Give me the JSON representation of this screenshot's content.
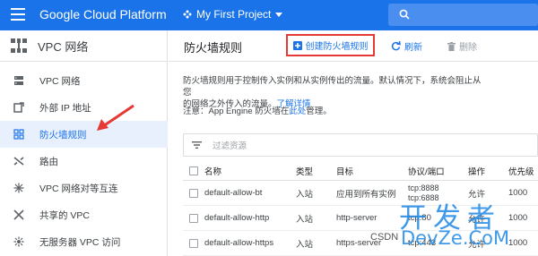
{
  "topbar": {
    "brand": "Google Cloud Platform",
    "project": "My First Project"
  },
  "sidebar": {
    "title": "VPC 网络",
    "items": [
      {
        "label": "VPC 网络",
        "icon": "network-icon"
      },
      {
        "label": "外部 IP 地址",
        "icon": "external-ip-icon"
      },
      {
        "label": "防火墙规则",
        "icon": "firewall-icon",
        "active": true
      },
      {
        "label": "路由",
        "icon": "route-icon"
      },
      {
        "label": "VPC 网络对等互连",
        "icon": "peering-icon"
      },
      {
        "label": "共享的 VPC",
        "icon": "shared-vpc-icon"
      },
      {
        "label": "无服务器 VPC 访问",
        "icon": "serverless-icon"
      }
    ]
  },
  "main": {
    "title": "防火墙规则",
    "create_label": "创建防火墙规则",
    "refresh_label": "刷新",
    "delete_label": "删除",
    "desc_line1": "防火墙规则用于控制传入实例和从实例传出的流量。默认情况下，系统会阻止从您",
    "desc_line2": "的网络之外传入的流量。",
    "learn_more": "了解详情",
    "note_prefix": "注意：App Engine 防火墙在",
    "note_link": "此处",
    "note_suffix": "管理。",
    "filter_placeholder": "过滤资源"
  },
  "table": {
    "headers": [
      "名称",
      "类型",
      "目标",
      "协议/端口",
      "操作",
      "优先级"
    ],
    "rows": [
      {
        "name": "default-allow-bt",
        "type": "入站",
        "target": "应用到所有实例",
        "proto1": "tcp:8888",
        "proto2": "tcp:6888",
        "action": "允许",
        "priority": "1000"
      },
      {
        "name": "default-allow-http",
        "type": "入站",
        "target": "http-server",
        "proto1": "tcp:80",
        "proto2": "",
        "action": "允许",
        "priority": "1000"
      },
      {
        "name": "default-allow-https",
        "type": "入站",
        "target": "https-server",
        "proto1": "tcp:443",
        "proto2": "",
        "action": "允许",
        "priority": "1000"
      }
    ]
  },
  "watermark": {
    "top": "开发者",
    "csdn": "CSDN",
    "bottom": "DevZe.CoM"
  },
  "colors": {
    "accent": "#1a73e8",
    "highlight_border": "#e53935",
    "active_bg": "#e8f0fe"
  }
}
